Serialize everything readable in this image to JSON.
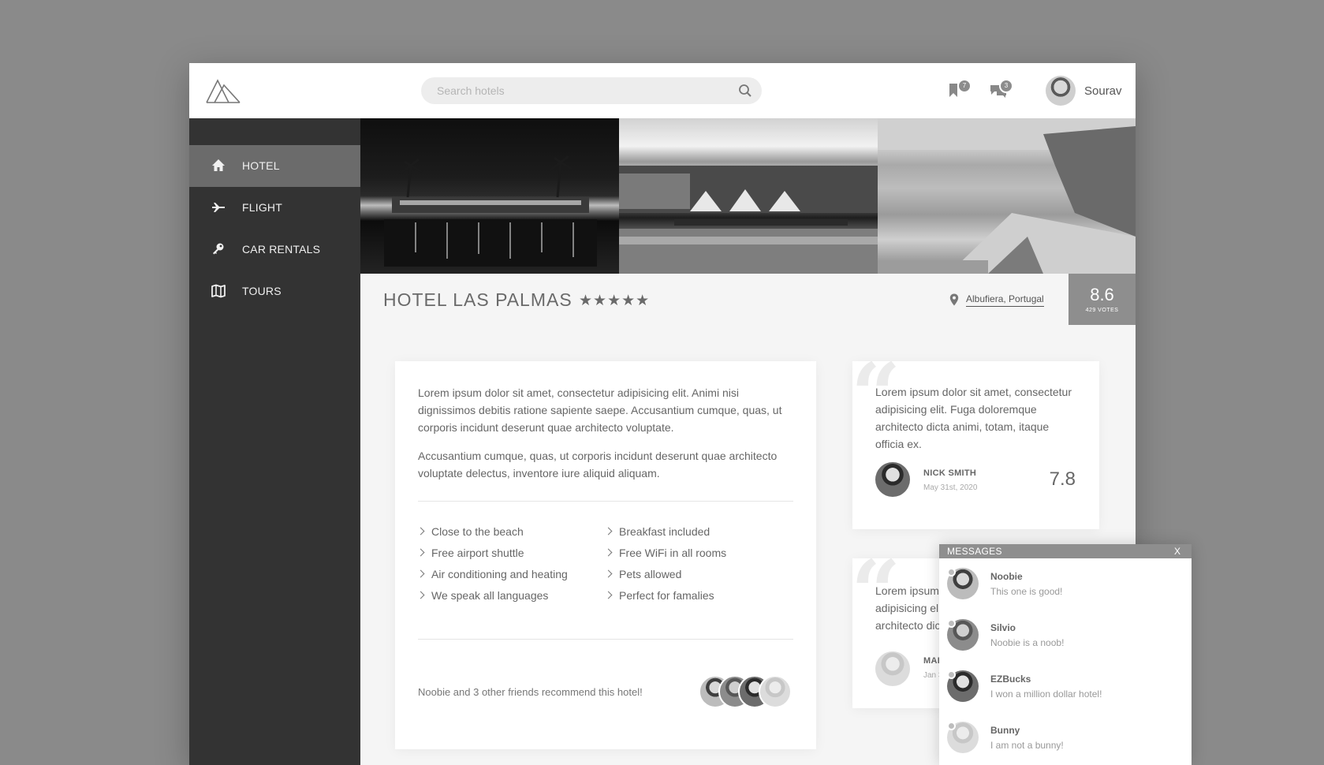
{
  "header": {
    "search_placeholder": "Search hotels",
    "bookmarks_badge": "7",
    "messages_badge": "3",
    "user_name": "Sourav"
  },
  "sidebar": {
    "items": [
      {
        "label": "HOTEL",
        "icon": "home-icon",
        "active": true
      },
      {
        "label": "FLIGHT",
        "icon": "plane-icon",
        "active": false
      },
      {
        "label": "CAR RENTALS",
        "icon": "key-icon",
        "active": false
      },
      {
        "label": "TOURS",
        "icon": "map-icon",
        "active": false
      }
    ]
  },
  "hotel": {
    "name": "HOTEL LAS PALMAS",
    "stars": "★★★★★",
    "location": "Albufiera, Portugal",
    "score": "8.6",
    "votes": "429 VOTES"
  },
  "description": {
    "paragraph1": "Lorem ipsum dolor sit amet, consectetur adipisicing elit. Animi nisi dignissimos debitis ratione sapiente saepe. Accusantium cumque, quas, ut corporis incidunt deserunt quae architecto voluptate.",
    "paragraph2": "Accusantium cumque, quas, ut corporis incidunt deserunt quae architecto voluptate delectus, inventore iure aliquid aliquam.",
    "features_left": [
      "Close to the beach",
      "Free airport shuttle",
      "Air conditioning and heating",
      "We speak all languages"
    ],
    "features_right": [
      "Breakfast included",
      "Free WiFi in all rooms",
      "Pets allowed",
      "Perfect for famalies"
    ],
    "recommend_text": "Noobie and 3 other friends recommend this hotel!"
  },
  "reviews": [
    {
      "text": "Lorem ipsum dolor sit amet, consectetur adipisicing elit. Fuga doloremque architecto dicta animi, totam, itaque officia ex.",
      "name": "NICK SMITH",
      "date": "May 31st, 2020",
      "score": "7.8"
    },
    {
      "text": "Lorem ipsum dolor sit amet, consectetur adipisicing elit. Fuga doloremque architecto dicta animi.",
      "name": "MARIA",
      "date": "Jan 3",
      "score": ""
    }
  ],
  "messages": {
    "title": "MESSAGES",
    "close": "X",
    "items": [
      {
        "name": "Noobie",
        "text": "This one is good!"
      },
      {
        "name": "Silvio",
        "text": "Noobie is a noob!"
      },
      {
        "name": "EZBucks",
        "text": "I won a million dollar hotel!"
      },
      {
        "name": "Bunny",
        "text": "I am not a bunny!"
      }
    ]
  }
}
